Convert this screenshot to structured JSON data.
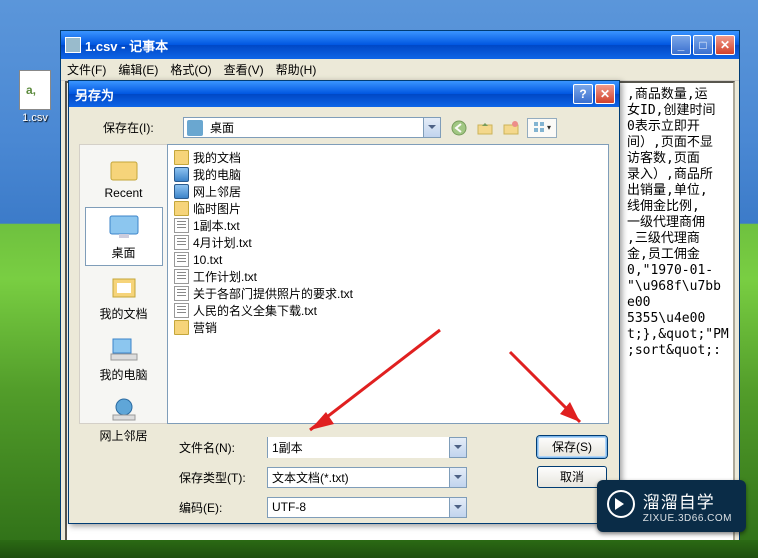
{
  "desktop": {
    "icon_label": "1.csv"
  },
  "notepad": {
    "title": "1.csv - 记事本",
    "menu": {
      "file": "文件(F)",
      "edit": "编辑(E)",
      "format": "格式(O)",
      "view": "查看(V)",
      "help": "帮助(H)"
    },
    "lines": [
      ",商品数量,运",
      "女ID,创建时间",
      "0表示立即开",
      "间）,页面不显",
      "访客数,页面",
      "录入）,商品所",
      "出销量,单位,",
      "线佣金比例,",
      "一级代理商佣",
      ",三级代理商",
      "金,员工佣金",
      "",
      "0,\"1970-01-",
      "",
      "\"\\u968f\\u7bb",
      "e00",
      "5355\\u4e00",
      "",
      "",
      "t;},&quot;\"PM",
      "",
      ";sort&quot;:"
    ]
  },
  "saveas": {
    "title": "另存为",
    "save_in_label": "保存在(I):",
    "save_in_value": "桌面",
    "places": {
      "recent": "Recent",
      "desktop": "桌面",
      "mydocs": "我的文档",
      "mycomputer": "我的电脑",
      "network": "网上邻居"
    },
    "files": [
      {
        "icon": "folder",
        "name": "我的文档"
      },
      {
        "icon": "sys",
        "name": "我的电脑"
      },
      {
        "icon": "sys",
        "name": "网上邻居"
      },
      {
        "icon": "folder",
        "name": "临时图片"
      },
      {
        "icon": "txt",
        "name": "1副本.txt"
      },
      {
        "icon": "txt",
        "name": "4月计划.txt"
      },
      {
        "icon": "txt",
        "name": "10.txt"
      },
      {
        "icon": "txt",
        "name": "工作计划.txt"
      },
      {
        "icon": "txt",
        "name": "关于各部门提供照片的要求.txt"
      },
      {
        "icon": "txt",
        "name": "人民的名义全集下载.txt"
      },
      {
        "icon": "folder",
        "name": "营销"
      }
    ],
    "filename_label": "文件名(N):",
    "filename_value": "1副本",
    "filetype_label": "保存类型(T):",
    "filetype_value": "文本文档(*.txt)",
    "encoding_label": "编码(E):",
    "encoding_value": "UTF-8",
    "save_btn": "保存(S)",
    "cancel_btn": "取消"
  },
  "watermark": {
    "title": "溜溜自学",
    "url": "ZIXUE.3D66.COM"
  }
}
